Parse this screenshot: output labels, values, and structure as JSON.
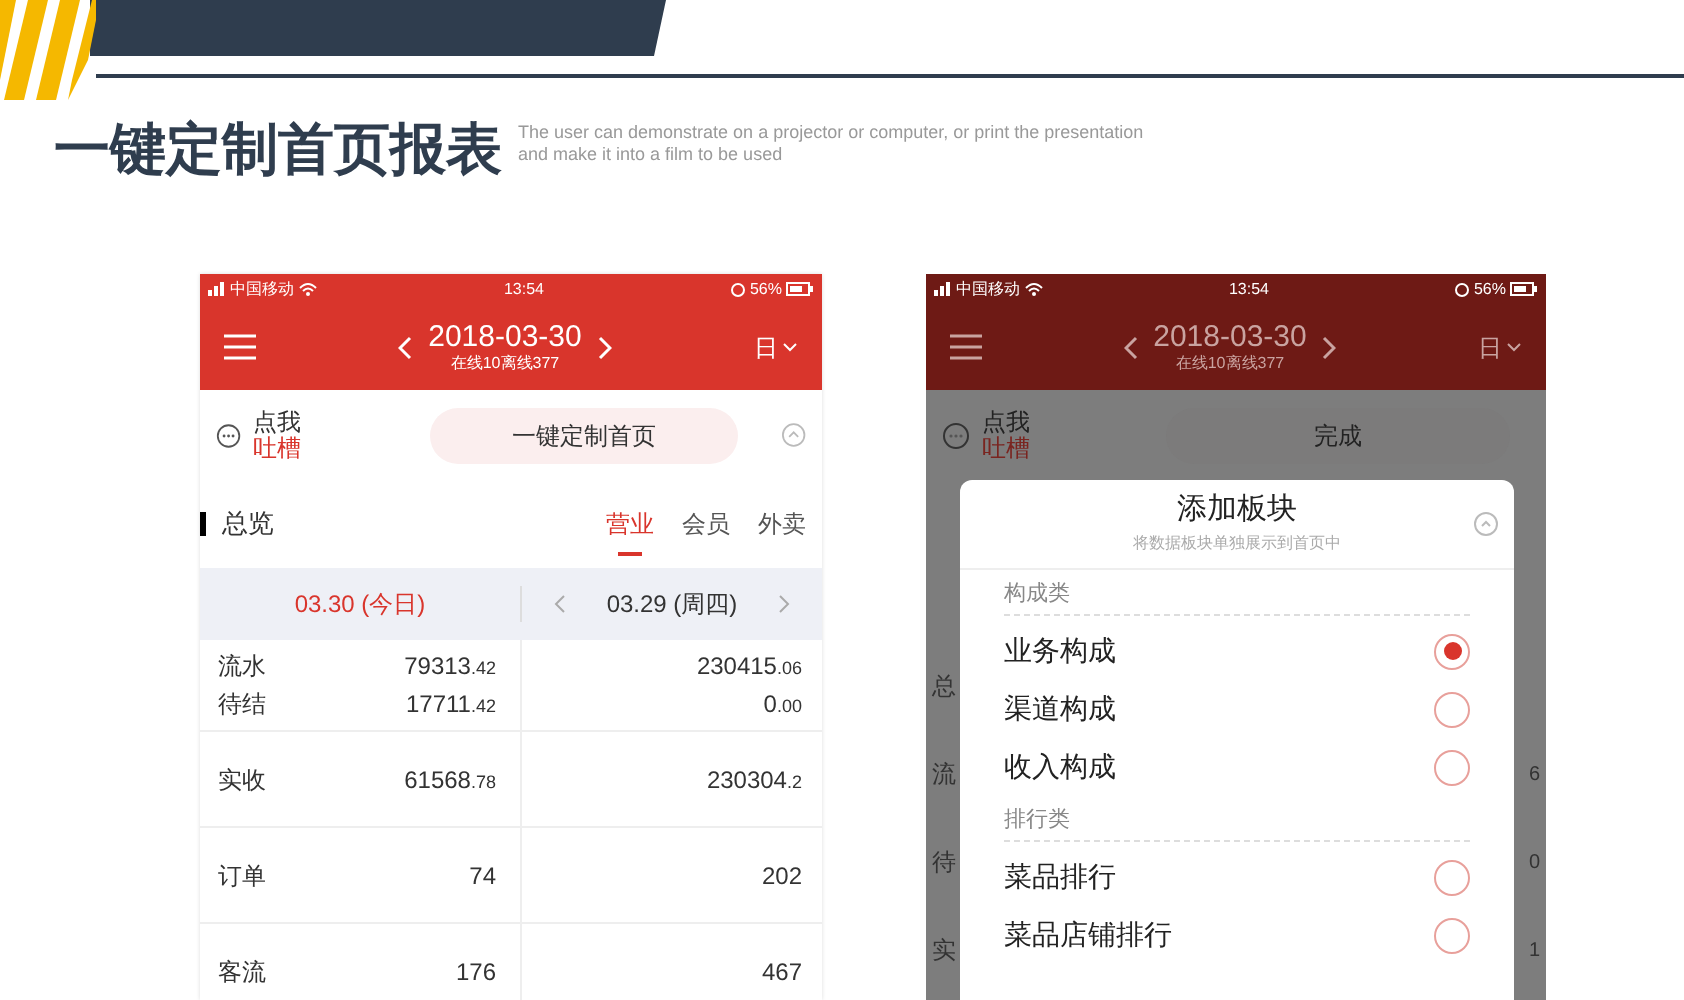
{
  "title": "一键定制首页报表",
  "subtitle": [
    "The user can demonstrate on a projector or computer, or print the presentation",
    "and make it into a film to be used"
  ],
  "phone1": {
    "status": {
      "carrier": "中国移动",
      "time": "13:54",
      "battery": "56%"
    },
    "nav": {
      "date": "2018-03-30",
      "online": "在线10离线377",
      "period": "日"
    },
    "feedback": {
      "line1": "点我",
      "line2": "吐槽"
    },
    "action": "一键定制首页",
    "section": "总览",
    "tabs": [
      {
        "label": "营业",
        "selected": true
      },
      {
        "label": "会员",
        "selected": false
      },
      {
        "label": "外卖",
        "selected": false
      }
    ],
    "compare": {
      "today": "03.30 (今日)",
      "other": "03.29 (周四)"
    },
    "rows": [
      {
        "items": [
          {
            "label": "流水",
            "value": "79313",
            "decimals": ".42",
            "value2": "230415",
            "decimals2": ".06"
          },
          {
            "label": "待结",
            "value": "17711",
            "decimals": ".42",
            "value2": "0",
            "decimals2": ".00"
          }
        ]
      },
      {
        "items": [
          {
            "label": "实收",
            "value": "61568",
            "decimals": ".78",
            "value2": "230304",
            "decimals2": ".2"
          }
        ]
      },
      {
        "items": [
          {
            "label": "订单",
            "value": "74",
            "value2": "202"
          }
        ]
      },
      {
        "items": [
          {
            "label": "客流",
            "value": "176",
            "value2": "467"
          }
        ]
      }
    ]
  },
  "phone2": {
    "status": {
      "carrier": "中国移动",
      "time": "13:54",
      "battery": "56%"
    },
    "nav": {
      "date": "2018-03-30",
      "online": "在线10离线377",
      "period": "日"
    },
    "feedback": {
      "line1": "点我",
      "line2": "吐槽"
    },
    "action": "完成",
    "background_rows": [
      {
        "label": "总"
      },
      {
        "label": "流",
        "value": "6"
      },
      {
        "label": "待",
        "value": "0"
      },
      {
        "label": "实",
        "value": "1"
      }
    ],
    "dialog": {
      "title": "添加板块",
      "subtitle": "将数据板块单独展示到首页中",
      "groups": [
        {
          "heading": "构成类",
          "items": [
            {
              "label": "业务构成",
              "selected": true
            },
            {
              "label": "渠道构成",
              "selected": false
            },
            {
              "label": "收入构成",
              "selected": false
            }
          ]
        },
        {
          "heading": "排行类",
          "items": [
            {
              "label": "菜品排行",
              "selected": false
            },
            {
              "label": "菜品店铺排行",
              "selected": false
            }
          ]
        }
      ]
    }
  }
}
